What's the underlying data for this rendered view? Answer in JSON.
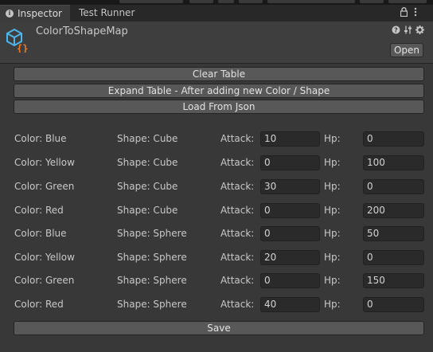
{
  "tabs": [
    {
      "label": "Inspector"
    },
    {
      "label": "Test Runner"
    }
  ],
  "header": {
    "object_name": "ColorToShapeMap",
    "open_label": "Open"
  },
  "buttons": {
    "clear": "Clear Table",
    "expand": "Expand Table - After adding new Color / Shape",
    "load": "Load From Json",
    "save": "Save"
  },
  "rows": [
    {
      "color": "Color: Blue",
      "shape": "Shape: Cube",
      "attack_label": "Attack:",
      "attack": "10",
      "hp_label": "Hp:",
      "hp": "0"
    },
    {
      "color": "Color: Yellow",
      "shape": "Shape: Cube",
      "attack_label": "Attack:",
      "attack": "0",
      "hp_label": "Hp:",
      "hp": "100"
    },
    {
      "color": "Color: Green",
      "shape": "Shape: Cube",
      "attack_label": "Attack:",
      "attack": "30",
      "hp_label": "Hp:",
      "hp": "0"
    },
    {
      "color": "Color: Red",
      "shape": "Shape: Cube",
      "attack_label": "Attack:",
      "attack": "0",
      "hp_label": "Hp:",
      "hp": "200"
    },
    {
      "color": "Color: Blue",
      "shape": "Shape: Sphere",
      "attack_label": "Attack:",
      "attack": "0",
      "hp_label": "Hp:",
      "hp": "50"
    },
    {
      "color": "Color: Yellow",
      "shape": "Shape: Sphere",
      "attack_label": "Attack:",
      "attack": "20",
      "hp_label": "Hp:",
      "hp": "0"
    },
    {
      "color": "Color: Green",
      "shape": "Shape: Sphere",
      "attack_label": "Attack:",
      "attack": "0",
      "hp_label": "Hp:",
      "hp": "150"
    },
    {
      "color": "Color: Red",
      "shape": "Shape: Sphere",
      "attack_label": "Attack:",
      "attack": "40",
      "hp_label": "Hp:",
      "hp": "0"
    }
  ],
  "icons": {
    "tab_info": "info-icon",
    "lock": "lock-icon",
    "menu": "kebab-menu-icon",
    "script": "scriptable-object-icon",
    "help": "help-icon",
    "presets": "presets-icon",
    "settings": "gear-icon"
  },
  "colors": {
    "background": "#383838",
    "header": "#3e3e3e",
    "button": "#585858",
    "field": "#2a2a2a",
    "script_icon_blue": "#4fb4e8",
    "script_icon_orange": "#f07a2a"
  }
}
